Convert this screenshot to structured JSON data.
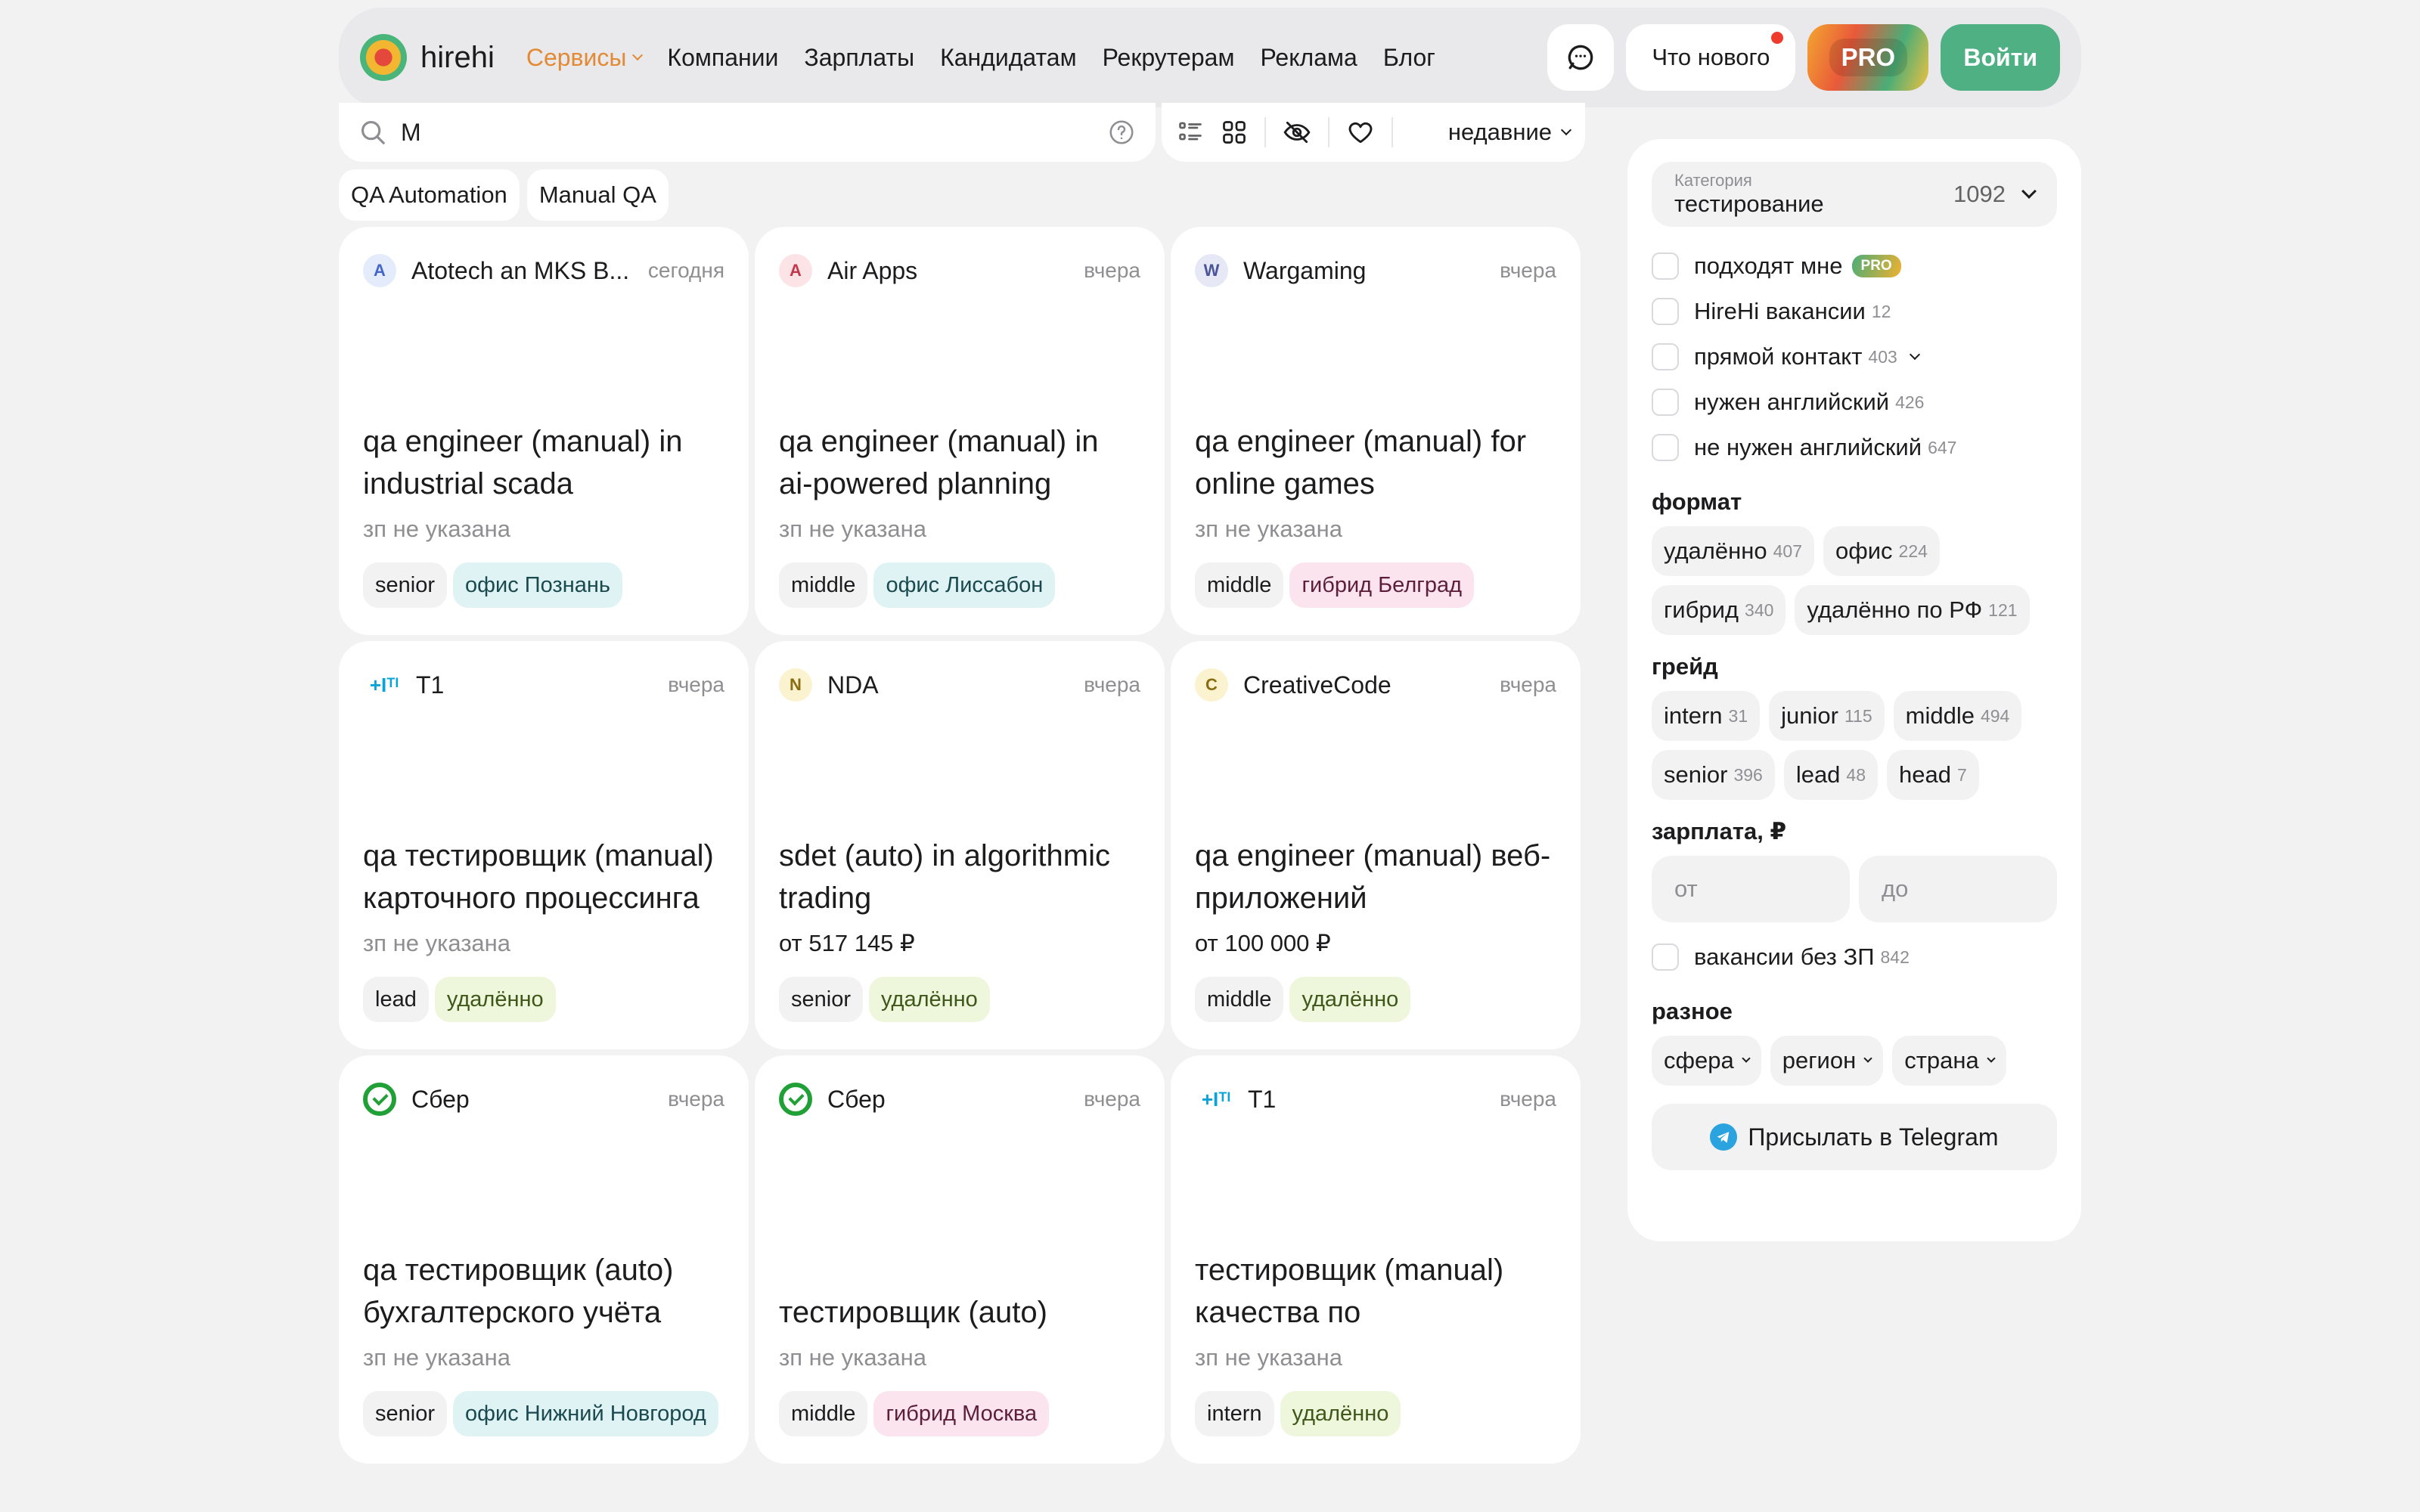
{
  "header": {
    "logo_text": "hirehi",
    "nav": [
      {
        "label": "Сервисы",
        "accent": true
      },
      {
        "label": "Компании"
      },
      {
        "label": "Зарплаты"
      },
      {
        "label": "Кандидатам"
      },
      {
        "label": "Рекрутерам"
      },
      {
        "label": "Реклама"
      },
      {
        "label": "Блог"
      }
    ],
    "whats_new": "Что нового",
    "pro": "PRO",
    "login": "Войти"
  },
  "search": {
    "value": "M",
    "placeholder": ""
  },
  "toolbar": {
    "sort_label": "недавние"
  },
  "quick_tags": [
    "QA Automation",
    "Manual QA"
  ],
  "cards": [
    {
      "logo": "A",
      "logo_bg": "#e4ecfb",
      "logo_fg": "#4467c7",
      "company": "Atotech an MKS B...",
      "date": "сегодня",
      "title": "qa engineer (manual) in industrial scada",
      "salary": "зп не указана",
      "grade": "senior",
      "location": "офис Познань",
      "location_type": "office"
    },
    {
      "logo": "A",
      "logo_bg": "#fbe3e6",
      "logo_fg": "#c6364a",
      "company": "Air Apps",
      "date": "вчера",
      "title": "qa engineer (manual) in ai-powered planning",
      "salary": "зп не указана",
      "grade": "middle",
      "location": "офис Лиссабон",
      "location_type": "office"
    },
    {
      "logo": "W",
      "logo_bg": "#e6e8f6",
      "logo_fg": "#4b5499",
      "company": "Wargaming",
      "date": "вчера",
      "title": "qa engineer (manual) for online games",
      "salary": "зп не указана",
      "grade": "middle",
      "location": "гибрид Белград",
      "location_type": "hybrid"
    },
    {
      "logo": "+Iᵀᴵ",
      "logo_type": "t1",
      "company": "T1",
      "date": "вчера",
      "title": "qa тестировщик (manual) карточного процессинга",
      "salary": "зп не указана",
      "grade": "lead",
      "location": "удалённо",
      "location_type": "remote"
    },
    {
      "logo": "N",
      "logo_bg": "#fbf2cf",
      "logo_fg": "#8a6d10",
      "company": "NDA",
      "date": "вчера",
      "title": "sdet (auto) in algorithmic trading",
      "salary": "от 517 145 ₽",
      "salary_set": true,
      "grade": "senior",
      "location": "удалённо",
      "location_type": "remote"
    },
    {
      "logo": "C",
      "logo_bg": "#fbf2cf",
      "logo_fg": "#8a6d10",
      "company": "CreativeCode",
      "date": "вчера",
      "title": "qa engineer (manual) веб-приложений",
      "salary": "от 100 000 ₽",
      "salary_set": true,
      "grade": "middle",
      "location": "удалённо",
      "location_type": "remote"
    },
    {
      "logo": "",
      "logo_type": "sber",
      "company": "Сбер",
      "date": "вчера",
      "title": "qa тестировщик (auto) бухгалтерского учёта",
      "salary": "зп не указана",
      "grade": "senior",
      "location": "офис Нижний Новгород",
      "location_type": "office"
    },
    {
      "logo": "",
      "logo_type": "sber",
      "company": "Сбер",
      "date": "вчера",
      "title": "тестировщик (auto)",
      "salary": "зп не указана",
      "grade": "middle",
      "location": "гибрид Москва",
      "location_type": "hybrid"
    },
    {
      "logo": "+Iᵀᴵ",
      "logo_type": "t1",
      "company": "T1",
      "date": "вчера",
      "title": "тестировщик (manual) качества по",
      "salary": "зп не указана",
      "grade": "intern",
      "location": "удалённо",
      "location_type": "remote"
    }
  ],
  "sidebar": {
    "category_label": "Категория",
    "category_value": "тестирование",
    "category_count": "1092",
    "checks": [
      {
        "label": "подходят мне",
        "count": "",
        "pro": "PRO"
      },
      {
        "label": "HireHi вакансии",
        "count": "12"
      },
      {
        "label": "прямой контакт",
        "count": "403",
        "expand": true
      },
      {
        "label": "нужен английский",
        "count": "426"
      },
      {
        "label": "не нужен английский",
        "count": "647"
      }
    ],
    "format_title": "формат",
    "format": [
      {
        "label": "удалённо",
        "count": "407"
      },
      {
        "label": "офис",
        "count": "224"
      },
      {
        "label": "гибрид",
        "count": "340"
      },
      {
        "label": "удалённо по РФ",
        "count": "121"
      }
    ],
    "grade_title": "грейд",
    "grades": [
      {
        "label": "intern",
        "count": "31"
      },
      {
        "label": "junior",
        "count": "115"
      },
      {
        "label": "middle",
        "count": "494"
      },
      {
        "label": "senior",
        "count": "396"
      },
      {
        "label": "lead",
        "count": "48"
      },
      {
        "label": "head",
        "count": "7"
      }
    ],
    "salary_title": "зарплата, ₽",
    "salary_from": "от",
    "salary_to": "до",
    "no_salary": {
      "label": "вакансии без ЗП",
      "count": "842"
    },
    "misc_title": "разное",
    "misc": [
      "сфера",
      "регион",
      "страна"
    ],
    "telegram": "Присылать в Telegram"
  },
  "colors": {
    "accent_green": "#4fb084",
    "accent_orange": "#e28a35",
    "telegram_blue": "#2aa3df"
  }
}
